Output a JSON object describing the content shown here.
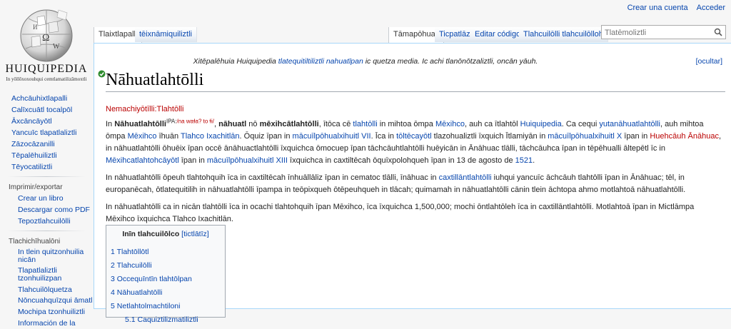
{
  "personal": {
    "create_account": "Crear una cuenta",
    "login": "Acceder"
  },
  "logo": {
    "wordmark": "HUIQUIPEDIA",
    "tagline": "In yōllōxoxouhqui cemtlamatilizāmoxtli"
  },
  "sidebar": {
    "nav": [
      "Achcāuhixtlapalli",
      "Calīxcuātl tocalpōl",
      "Āxcāncāyōtl",
      "Yancuīc tlapatlaliztli",
      "Zāzocāzanilli",
      "Tēpalēhuiliztli",
      "Tēyocatiliztli"
    ],
    "print_heading": "Imprimir/exportar",
    "print_items": [
      "Crear un libro",
      "Descargar como PDF",
      "Tepoztlahcuilōlli"
    ],
    "tools_heading": "Tlachichīhualōni",
    "tools_items": [
      "In tlein quitzonhuilia nicān",
      "Tlapatlaliztli tzonhuilizpan",
      "Tlahcuilōlquetza",
      "Nōncuahquīzqui āmatl",
      "Mochipa tzonhuiliztli",
      "Información de la"
    ]
  },
  "tabs": {
    "left": [
      "Tlaixtlapalli",
      "tēixnāmiquiliztli"
    ],
    "right": [
      "Tāmapōhuaz",
      "Ticpatlāz",
      "Editar código",
      "Tlahcuilōlli tlahcuilōlloh"
    ]
  },
  "search": {
    "placeholder": "Tlatēmoliztli"
  },
  "notice": {
    "text_prefix": "Xitēpalēhuia Huiquipedia ",
    "text_link": "tlatequitiltiliztli nahuatīpan",
    "text_suffix": " ic quetza media. Ic achi tlanōnōtzaliztli, oncān yāuh.",
    "dismiss": "[ocultar]"
  },
  "page": {
    "title": "Nāhuatlahtōlli",
    "redirect": "Nemachiyōtīlli:Tlahtōlli",
    "p1": {
      "a": "In ",
      "b": "Nāhuatlahtōlli",
      "ipa_tag": "IPA:",
      "ipa": "/na waɬa? to ɬi/",
      "c": ", ",
      "d": "nāhuatl",
      "e": " nō ",
      "f": "mēxihcātlahtōlli",
      "g": ", ītōca cē ",
      "h": "tlahtōlli",
      "i": " in mihtoa ōmpa ",
      "j": "Mēxihco",
      "k": ", auh ca ītlahtōl ",
      "l": "Huiquipedia",
      "m": ". Ca cequi ",
      "n": "yutanāhuatlahtōlli",
      "o": ", auh mihtoa ōmpa ",
      "p": "Mēxihco",
      "q": " īhuān ",
      "r": "Tlahco Ixachitlān",
      "s": ". Ōquiz īpan in ",
      "t": "mācuīlpōhualxihuitl VII",
      "u": ". Īca in ",
      "v": "tōltēcayōtl",
      "w": " tlazohualiztli īxquich Ītlamiyān in ",
      "x": "mācuīlpōhualxihuitl X",
      "y": " īpan in ",
      "z": "Huehcāuh Ānāhuac",
      "aa": ", in nāhuatlahtōlli ōhuēix īpan occē ānāhuactlahtōlli īxquichca ōmocuep īpan tāchcāuhtlahtōlli huēyicān in Ānāhuac tlālli, tāchcāuhca īpan in tēpēhualli āltepētl īc in ",
      "ab": "Mēxihcatlahtohcāyōtl",
      "ac": " īpan in ",
      "ad": "mācuīlpōhualxihuitl XIII",
      "ae": " īxquichca in caxtiltēcah ōquīxpolohqueh īpan in 13 de agosto de ",
      "af": "1521",
      "ag": "."
    },
    "p2": {
      "a": "In nāhuatlahtōlli ōpeuh tlahtohquih īca in caxtiltēcah īnhuāllāliz īpan in cematoc tlālli, īnāhuac in ",
      "b": "caxtillāntlahtōlli",
      "c": " iuhqui yancuīc āchcāuh tlahtōlli īpan in Ānāhuac; tēl, in europanēcah, ōtlatequitilih in nāhuatlahtōlli īpampa in teōpixqueh ōtēpeuhqueh in tlācah; quimamah in nāhuatlahtōlli cānin tlein āchtopa ahmo motlahtoā nāhuatlahtōlli."
    },
    "p3": "In nāhuatlahtōlli ca in nicān tlahtōlli īca in ocachi tlahtohquih īpan Mēxihco, īca īxquichca 1,500,000; mochi ōntlahtōleh īca in caxtillāntlahtōlli. Motlahtoā īpan in Mictlāmpa Mēxihco īxquichca Tlahco Ixachitlān."
  },
  "toc": {
    "title": "Inīn tlahcuilōlco",
    "toggle": "[tictlātīz]",
    "items": [
      {
        "num": "1",
        "label": "Tlahtōllōtl"
      },
      {
        "num": "2",
        "label": "Tlahcuilōlli"
      },
      {
        "num": "3",
        "label": "Occequīntīn tlahtōlpan"
      },
      {
        "num": "4",
        "label": "Nāhuatlahtōlli"
      },
      {
        "num": "5",
        "label": "Netlahtolmachtiloni"
      },
      {
        "num": "5.1",
        "label": "Caquiztilizmatiliztli"
      }
    ]
  },
  "colors": {
    "link": "#0645ad",
    "redlink": "#ba0000",
    "content_border": "#a7d7f9"
  }
}
